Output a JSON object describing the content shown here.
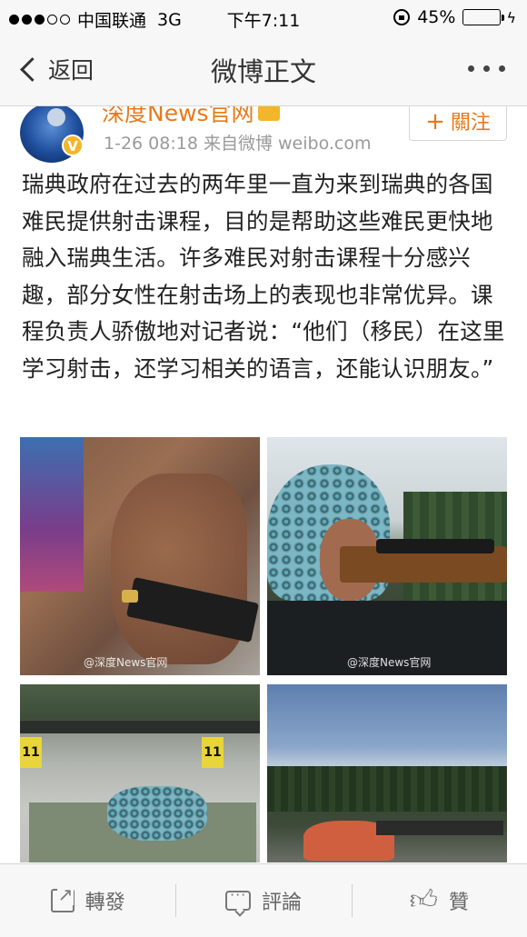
{
  "status_bar": {
    "signal_filled": 3,
    "signal_total": 5,
    "carrier": "中国联通",
    "network": "3G",
    "time": "下午7:11",
    "battery": "45%",
    "battery_level": 0.45,
    "battery_color": "#35c048"
  },
  "nav": {
    "back_label": "返回",
    "title": "微博正文",
    "more_icon": "more-icon"
  },
  "post": {
    "author": "深度News官网",
    "verified_badge": "V",
    "timestamp": "1-26 08:18",
    "source": "来自微博 weibo.com",
    "follow_plus": "+",
    "follow_label": "關注",
    "text": "瑞典政府在过去的两年里一直为来到瑞典的各国难民提供射击课程，目的是帮助这些难民更快地融入瑞典生活。许多难民对射击课程十分感兴趣，部分女性在射击场上的表现也非常优异。课程负责人骄傲地对记者说：“他们（移民）在这里学习射击，还学习相关的语言，还能认识朋友。”",
    "watermark_1": "@深度News官网",
    "watermark_2": "@深度News官网",
    "range_numbers": [
      "11",
      "11"
    ],
    "accent_color": "#e8791a"
  },
  "toolbar": {
    "repost_label": "轉發",
    "comment_label": "評論",
    "like_label": "贊"
  }
}
